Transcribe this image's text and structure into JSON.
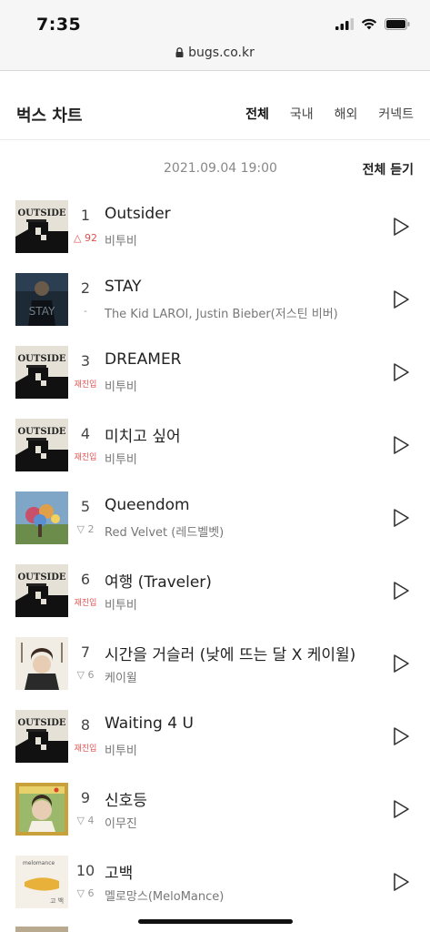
{
  "status": {
    "time": "7:35"
  },
  "browser": {
    "url": "bugs.co.kr"
  },
  "header": {
    "title": "벅스 차트",
    "tabs": [
      "전체",
      "국내",
      "해외",
      "커넥트"
    ]
  },
  "meta": {
    "date": "2021.09.04 19:00",
    "listen_all": "전체 듣기"
  },
  "colors": {
    "up": "#e05050",
    "neutral": "#999999"
  },
  "tracks": [
    {
      "rank": "1",
      "title": "Outsider",
      "artist": "비투비",
      "change": "△ 92",
      "change_type": "up",
      "cover": "outside"
    },
    {
      "rank": "2",
      "title": "STAY",
      "artist": "The Kid LAROI, Justin Bieber(저스틴 비버)",
      "change": "-",
      "change_type": "same",
      "cover": "stay"
    },
    {
      "rank": "3",
      "title": "DREAMER",
      "artist": "비투비",
      "change": "재진입",
      "change_type": "new",
      "cover": "outside"
    },
    {
      "rank": "4",
      "title": "미치고 싶어",
      "artist": "비투비",
      "change": "재진입",
      "change_type": "new",
      "cover": "outside"
    },
    {
      "rank": "5",
      "title": "Queendom",
      "artist": "Red Velvet (레드벨벳)",
      "change": "▽ 2",
      "change_type": "down",
      "cover": "queendom"
    },
    {
      "rank": "6",
      "title": "여행 (Traveler)",
      "artist": "비투비",
      "change": "재진입",
      "change_type": "new",
      "cover": "outside"
    },
    {
      "rank": "7",
      "title": "시간을 거슬러 (낮에 뜨는 달 X 케이윌)",
      "artist": "케이윌",
      "change": "▽ 6",
      "change_type": "down",
      "cover": "kwill"
    },
    {
      "rank": "8",
      "title": "Waiting 4 U",
      "artist": "비투비",
      "change": "재진입",
      "change_type": "new",
      "cover": "outside"
    },
    {
      "rank": "9",
      "title": "신호등",
      "artist": "이무진",
      "change": "▽ 4",
      "change_type": "down",
      "cover": "signal"
    },
    {
      "rank": "10",
      "title": "고백",
      "artist": "멜로망스(MeloMance)",
      "change": "▽ 6",
      "change_type": "down",
      "cover": "melomance"
    }
  ]
}
